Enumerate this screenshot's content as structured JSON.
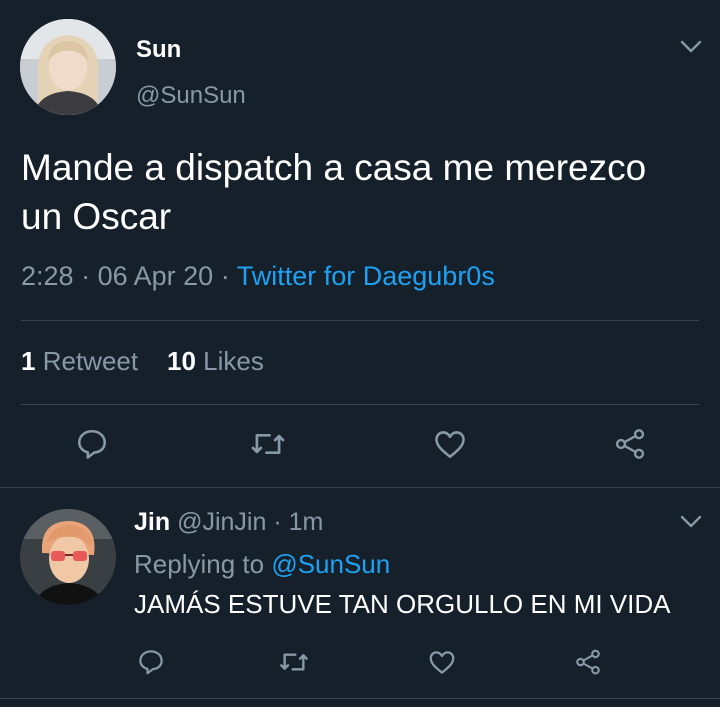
{
  "tweet": {
    "author_name": "Sun",
    "author_handle": "@SunSun",
    "text": "Mande a dispatch a casa me merezco un Oscar",
    "time": "2:28",
    "date": "06 Apr 20",
    "separator": "·",
    "source": "Twitter for Daegubr0s",
    "retweets_count": "1",
    "retweets_label": "Retweet",
    "likes_count": "10",
    "likes_label": "Likes",
    "actions": [
      "reply-icon",
      "retweet-icon",
      "like-icon",
      "share-icon"
    ]
  },
  "reply": {
    "author_name": "Jin",
    "author_handle": "@JinJin",
    "separator": "·",
    "time_ago": "1m",
    "replying_prefix": "Replying to",
    "replying_to": "@SunSun",
    "text": "JAMÁS ESTUVE TAN ORGULLO EN MI VIDA",
    "actions": [
      "reply-icon",
      "retweet-icon",
      "like-icon",
      "share-icon"
    ]
  },
  "colors": {
    "background": "#15202b",
    "secondary_text": "#8899a6",
    "link": "#1da1f2",
    "divider": "#38444d"
  }
}
